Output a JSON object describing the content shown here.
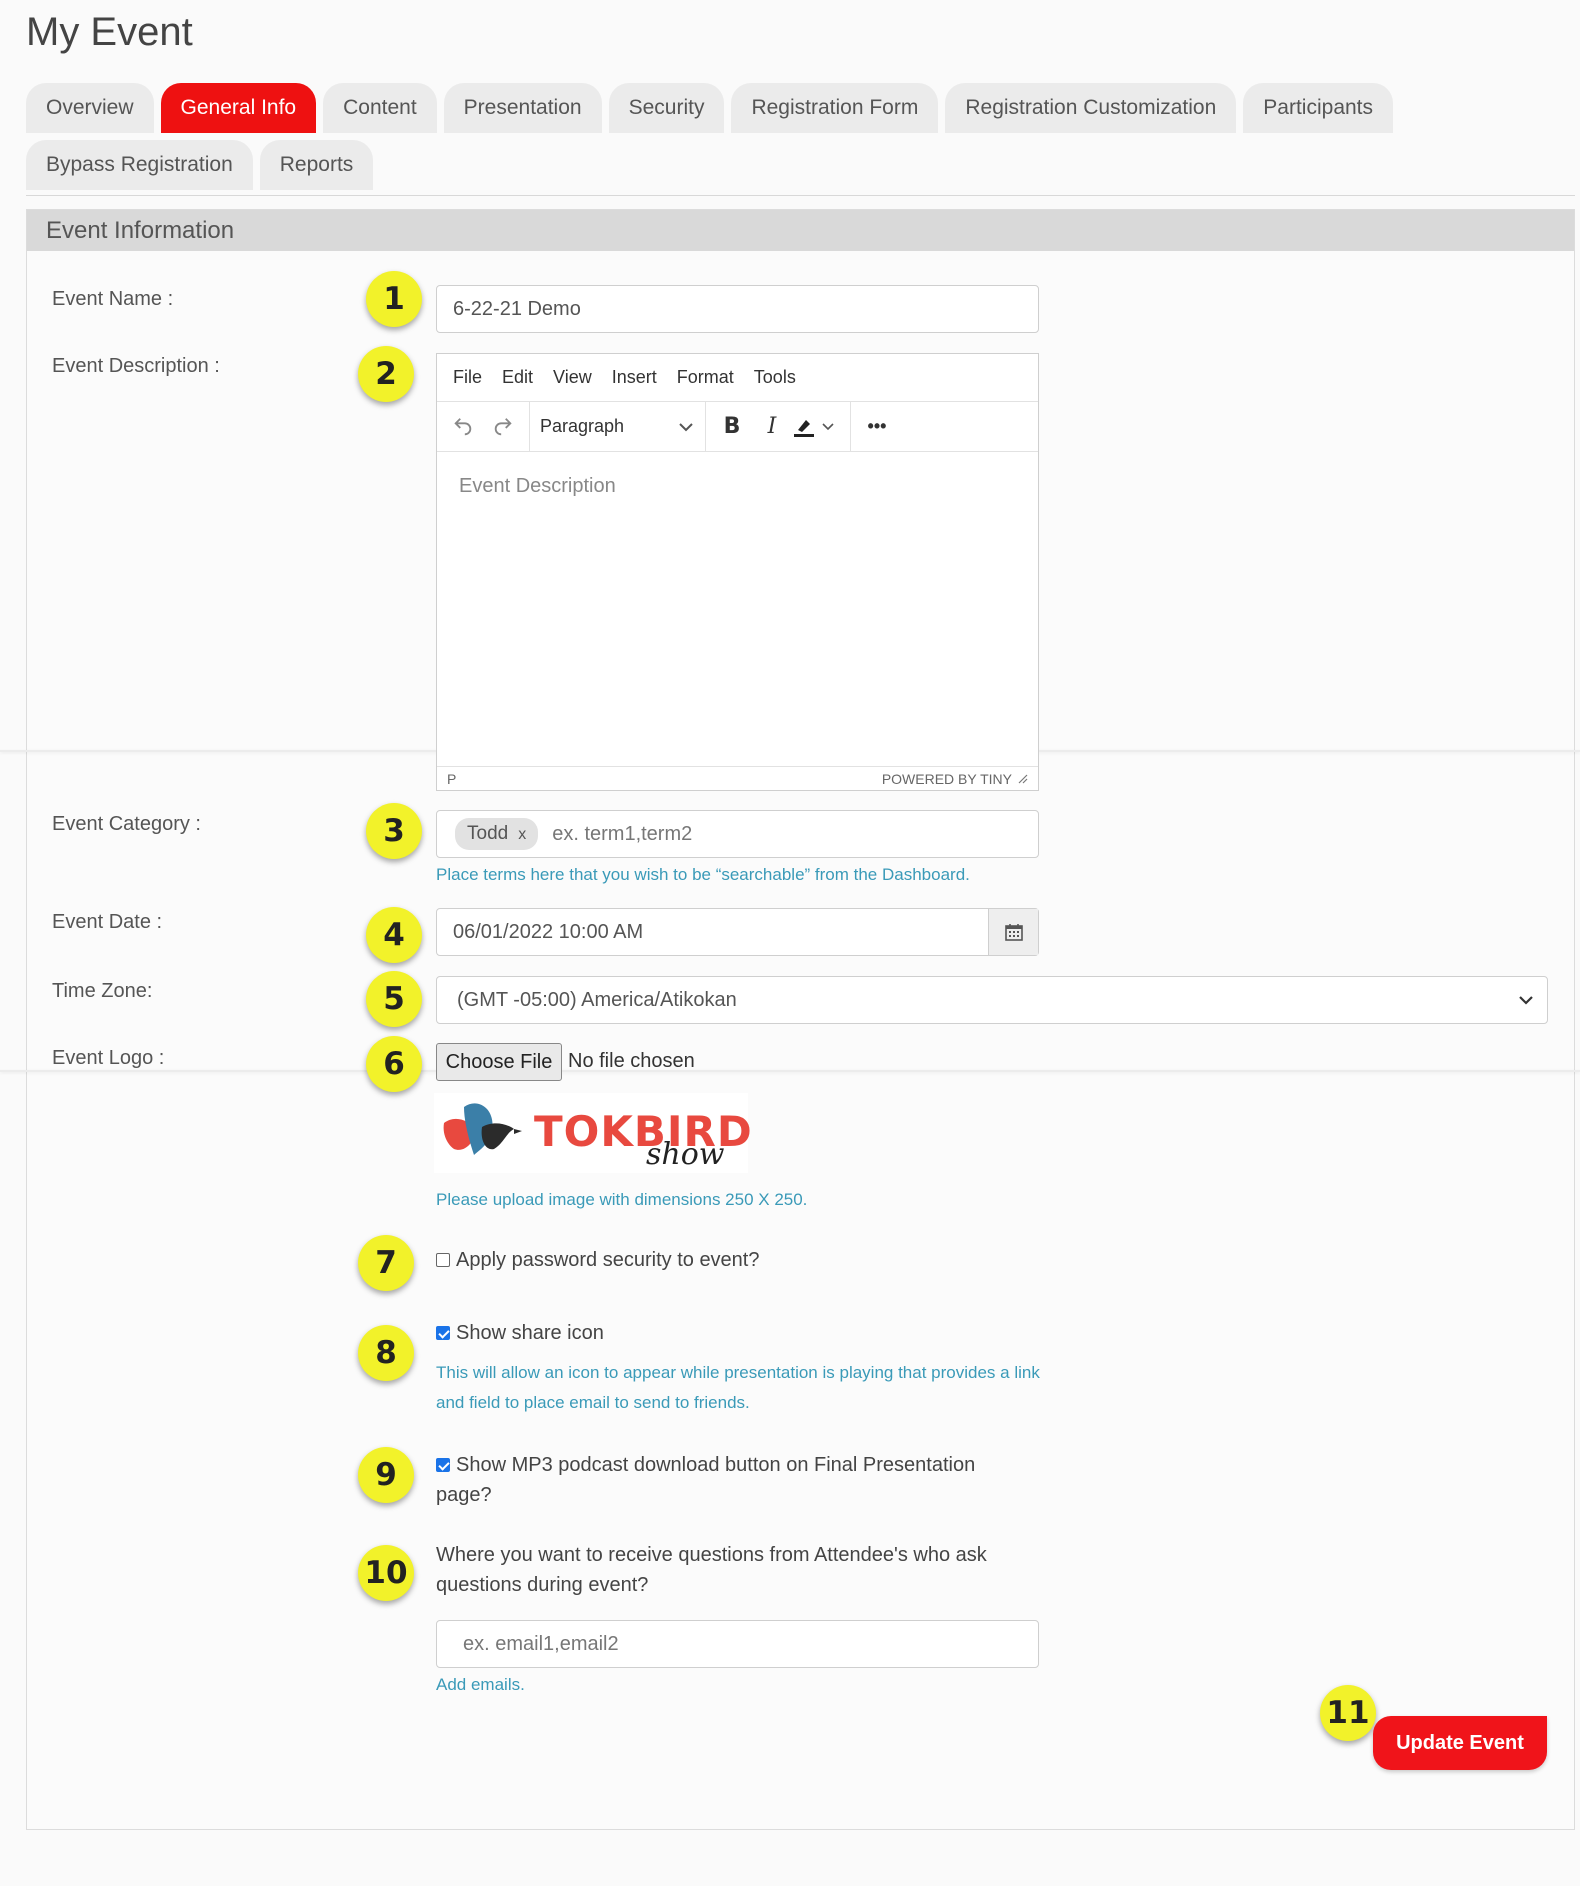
{
  "page_title": "My Event",
  "tabs": {
    "row1": [
      "Overview",
      "General Info",
      "Content",
      "Presentation",
      "Security",
      "Registration Form",
      "Registration Customization",
      "Participants"
    ],
    "row2": [
      "Bypass Registration",
      "Reports"
    ],
    "active": "General Info"
  },
  "panel": {
    "header": "Event Information"
  },
  "markers": [
    "1",
    "2",
    "3",
    "4",
    "5",
    "6",
    "7",
    "8",
    "9",
    "10",
    "11"
  ],
  "fields": {
    "event_name": {
      "label": "Event Name :",
      "value": "6-22-21 Demo"
    },
    "event_description": {
      "label": "Event Description :",
      "menu": [
        "File",
        "Edit",
        "View",
        "Insert",
        "Format",
        "Tools"
      ],
      "block_format": "Paragraph",
      "placeholder": "Event Description",
      "status_path": "P",
      "branding": "POWERED BY TINY"
    },
    "event_category": {
      "label": "Event Category :",
      "tags": [
        "Todd"
      ],
      "tag_remove": "x",
      "placeholder": "ex. term1,term2",
      "help": "Place terms here that you wish to be “searchable” from the Dashboard."
    },
    "event_date": {
      "label": "Event Date :",
      "value": "06/01/2022 10:00 AM"
    },
    "time_zone": {
      "label": "Time Zone:",
      "value": "(GMT -05:00) America/Atikokan"
    },
    "event_logo": {
      "label": "Event Logo :",
      "button": "Choose File",
      "status": "No file chosen",
      "logo_text": "TOKBIRD",
      "logo_script": "show",
      "help": "Please upload image with dimensions 250 X 250."
    },
    "password_security": {
      "label": "Apply password security to event?",
      "checked": false
    },
    "share_icon": {
      "label": "Show share icon",
      "checked": true,
      "help_line1": "This will allow an icon to appear while presentation is playing that provides a link",
      "help_line2": "and field to place email to send to friends."
    },
    "mp3_download": {
      "label_line1": "Show MP3 podcast download button on Final Presentation",
      "label_line2": "page?",
      "checked": true
    },
    "questions_email": {
      "label_line1": "Where you want to receive questions from Attendee's who ask",
      "label_line2": "questions during event?",
      "placeholder": "ex. email1,email2",
      "help": "Add emails."
    }
  },
  "update_button": "Update Event",
  "colors": {
    "accent": "#ee1111",
    "marker": "#f2f22a",
    "help_text": "#3a9ab8",
    "panel_header": "#d9d9d9"
  }
}
